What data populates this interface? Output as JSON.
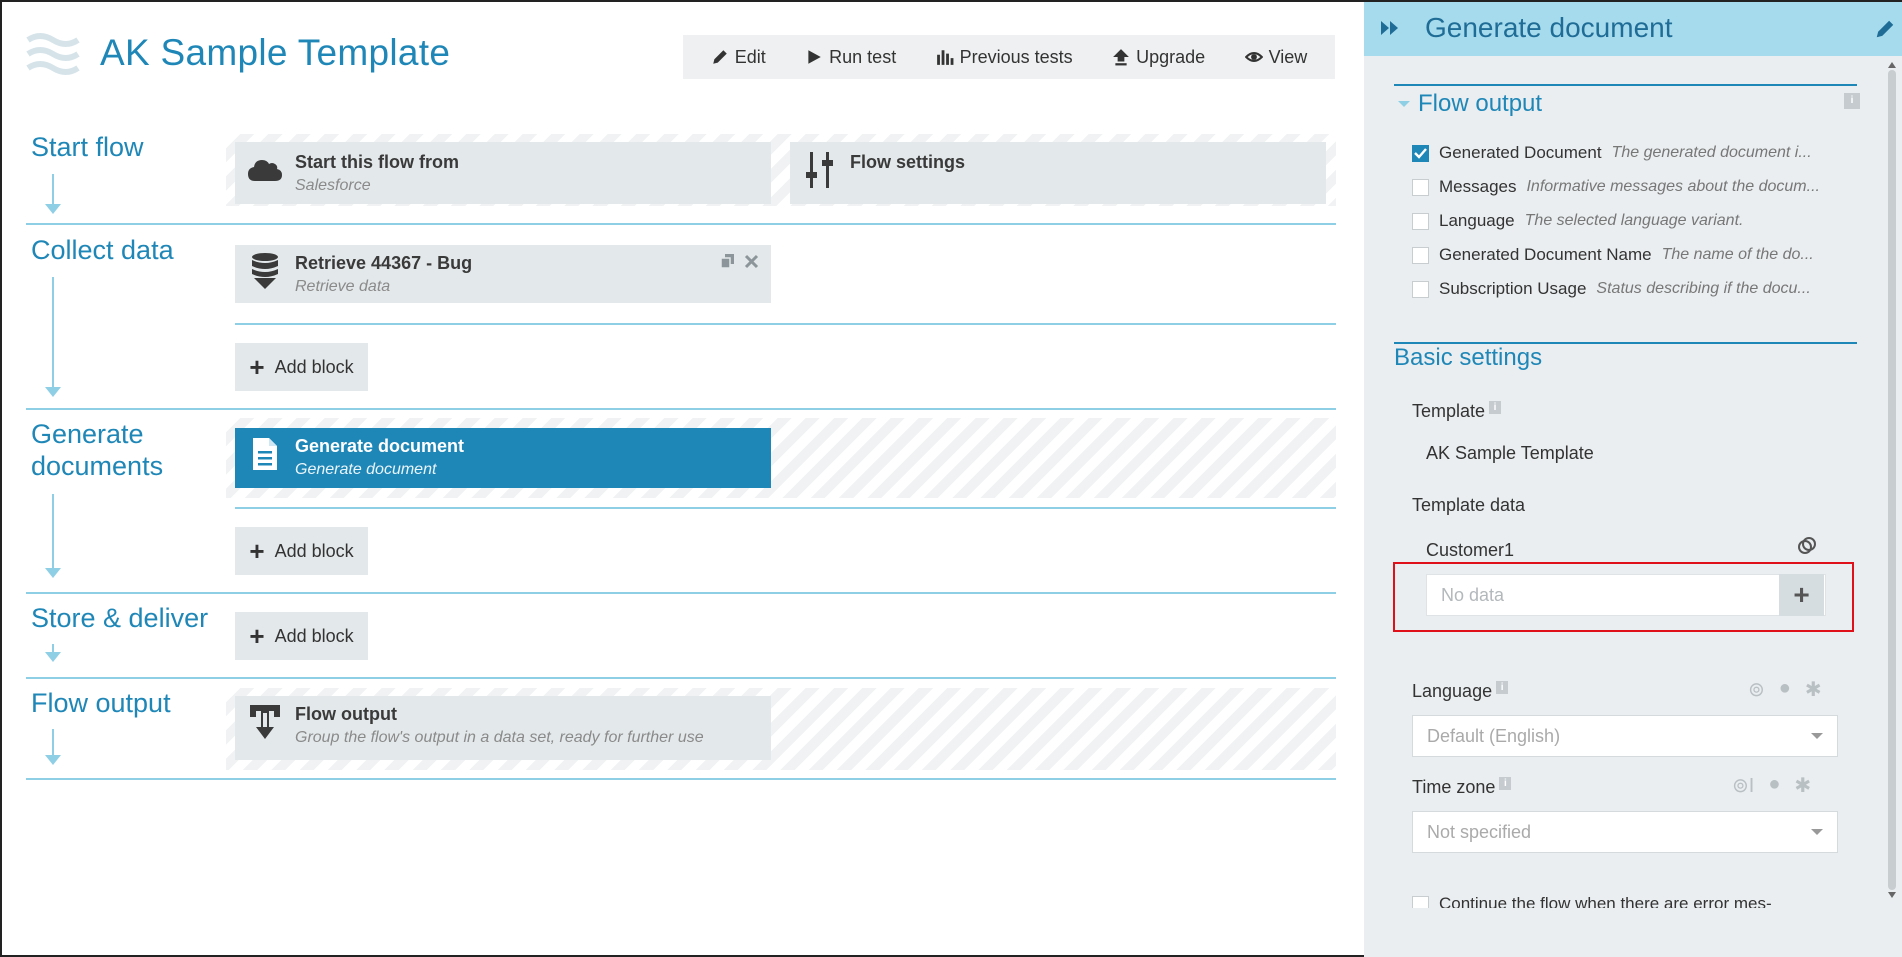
{
  "header": {
    "title": "AK Sample Template",
    "toolbar": [
      {
        "label": "Edit",
        "icon": "pencil-icon"
      },
      {
        "label": "Run test",
        "icon": "play-icon"
      },
      {
        "label": "Previous tests",
        "icon": "bar-chart-icon"
      },
      {
        "label": "Upgrade",
        "icon": "upload-arrow-icon"
      },
      {
        "label": "View",
        "icon": "eye-icon"
      }
    ]
  },
  "flow": {
    "sections": {
      "start": {
        "title": "Start flow"
      },
      "collect": {
        "title": "Collect data"
      },
      "generate": {
        "title": "Generate documents"
      },
      "store": {
        "title": "Store & deliver"
      },
      "output": {
        "title": "Flow output"
      }
    },
    "blocks": {
      "start_from": {
        "title": "Start this flow from",
        "subtitle": "Salesforce",
        "icon": "cloud-icon"
      },
      "flow_settings": {
        "title": "Flow settings",
        "icon": "sliders-icon"
      },
      "retrieve": {
        "title": "Retrieve 44367 - Bug",
        "subtitle": "Retrieve data",
        "icon": "database-icon"
      },
      "generate_doc": {
        "title": "Generate document",
        "subtitle": "Generate document",
        "icon": "document-icon"
      },
      "flow_output": {
        "title": "Flow output",
        "subtitle": "Group the flow's output in a data set, ready for further use",
        "icon": "output-icon"
      }
    },
    "add_block_label": "Add block"
  },
  "panel": {
    "title": "Generate document",
    "flow_output": {
      "heading": "Flow output",
      "items": [
        {
          "label": "Generated Document",
          "desc": "The generated document i...",
          "checked": true
        },
        {
          "label": "Messages",
          "desc": "Informative messages about the docum...",
          "checked": false
        },
        {
          "label": "Language",
          "desc": "The selected language variant.",
          "checked": false
        },
        {
          "label": "Generated Document Name",
          "desc": "The name of the do...",
          "checked": false
        },
        {
          "label": "Subscription Usage",
          "desc": "Status describing if the docu...",
          "checked": false
        }
      ]
    },
    "basic": {
      "heading": "Basic settings",
      "template_label": "Template",
      "template_value": "AK Sample Template",
      "template_data_label": "Template data",
      "customer_label": "Customer1",
      "no_data_placeholder": "No data",
      "language_label": "Language",
      "language_value": "Default (English)",
      "timezone_label": "Time zone",
      "timezone_value": "Not specified",
      "continue_label": "Continue the flow when there are error mes-"
    }
  },
  "colors": {
    "accent": "#1f87b7",
    "panel_header": "#a6dbee",
    "highlight_border": "#e0101a"
  }
}
